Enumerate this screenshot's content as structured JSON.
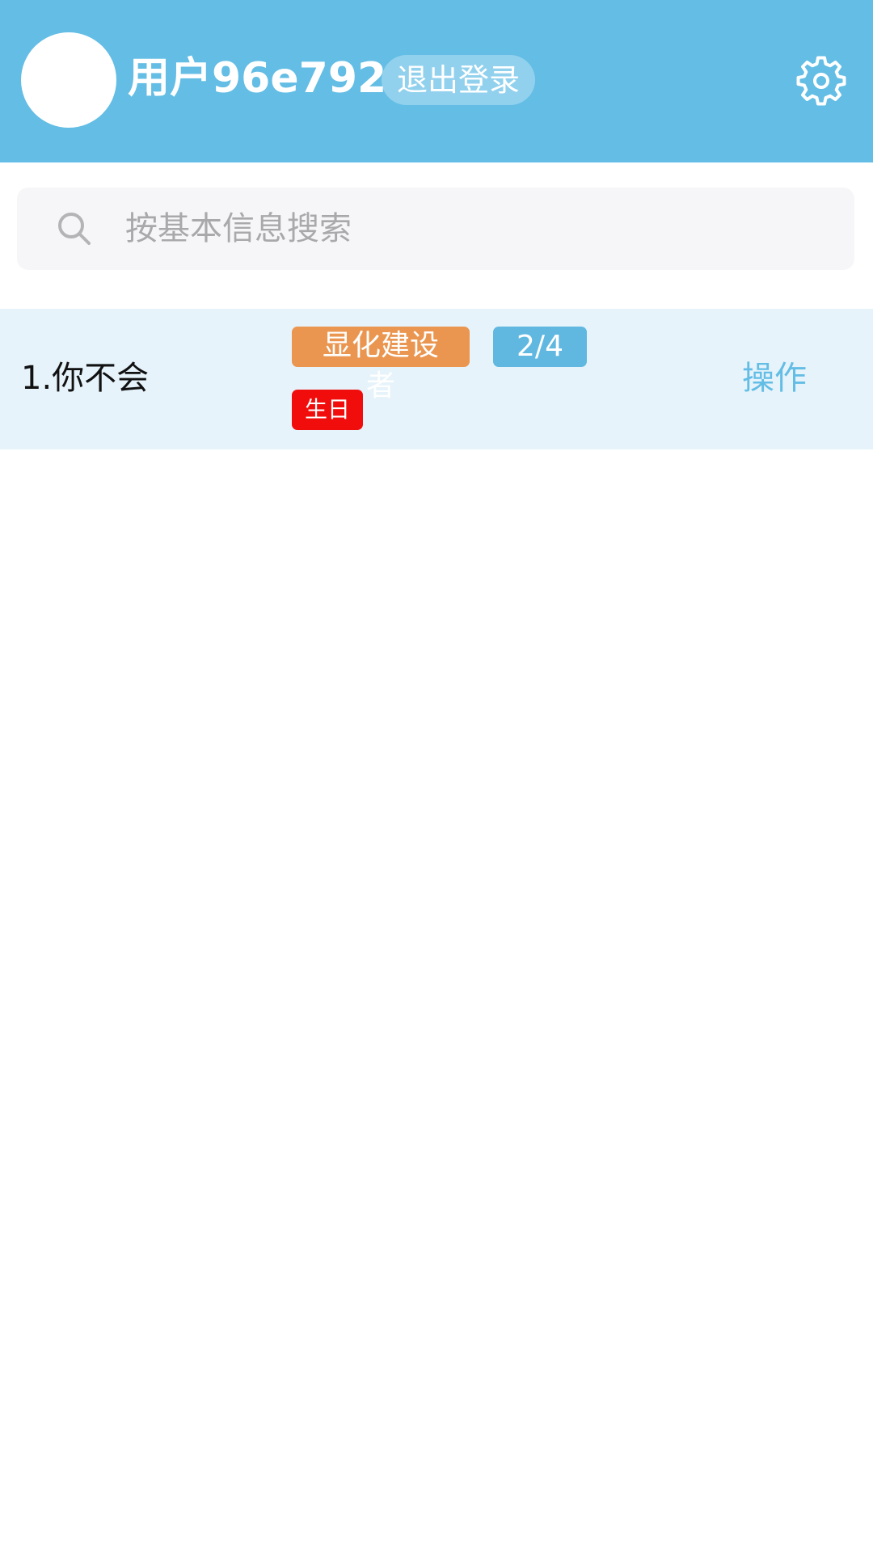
{
  "header": {
    "username": "用户96e792",
    "logout_label": "退出登录",
    "background_color": "#63bde5",
    "settings_icon": "gear-icon"
  },
  "search": {
    "placeholder": "按基本信息搜索",
    "value": "",
    "icon": "search-icon"
  },
  "list": {
    "items": [
      {
        "title": "1.你不会",
        "category_tag": "显化建设",
        "category_tag_overflow": "者",
        "progress_tag": "2/4",
        "birthday_tag": "生日",
        "action_label": "操作",
        "tag_colors": {
          "category": "#ea9650",
          "progress": "#60b8e1",
          "birthday": "#f20d0d"
        }
      }
    ]
  }
}
